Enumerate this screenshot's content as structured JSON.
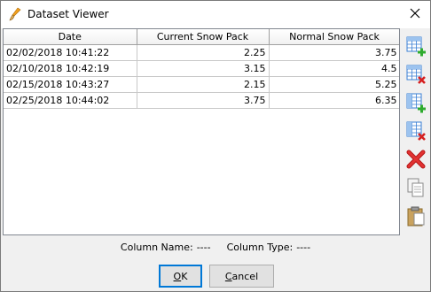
{
  "window": {
    "title": "Dataset Viewer"
  },
  "table": {
    "columns": [
      "Date",
      "Current Snow Pack",
      "Normal Snow Pack"
    ],
    "rows": [
      [
        "02/02/2018 10:41:22",
        "2.25",
        "3.75"
      ],
      [
        "02/10/2018 10:42:19",
        "3.15",
        "4.5"
      ],
      [
        "02/15/2018 10:43:27",
        "2.15",
        "5.25"
      ],
      [
        "02/25/2018 10:44:02",
        "3.75",
        "6.35"
      ]
    ]
  },
  "toolbar": {
    "buttons": [
      {
        "icon": "add-row-icon"
      },
      {
        "icon": "remove-row-icon"
      },
      {
        "icon": "add-column-icon"
      },
      {
        "icon": "remove-column-icon"
      },
      {
        "icon": "delete-icon"
      },
      {
        "icon": "copy-icon"
      },
      {
        "icon": "paste-icon"
      }
    ]
  },
  "status": {
    "column_name_label": "Column Name:",
    "column_name_value": "----",
    "column_type_label": "Column Type:",
    "column_type_value": "----"
  },
  "buttons": {
    "ok_mnemonic": "O",
    "ok_rest": "K",
    "cancel_mnemonic": "C",
    "cancel_rest": "ancel"
  },
  "colors": {
    "accent": "#0078d7",
    "add_green": "#2eab2e",
    "remove_red": "#d62020",
    "grid_blue": "#3a7fd4"
  }
}
